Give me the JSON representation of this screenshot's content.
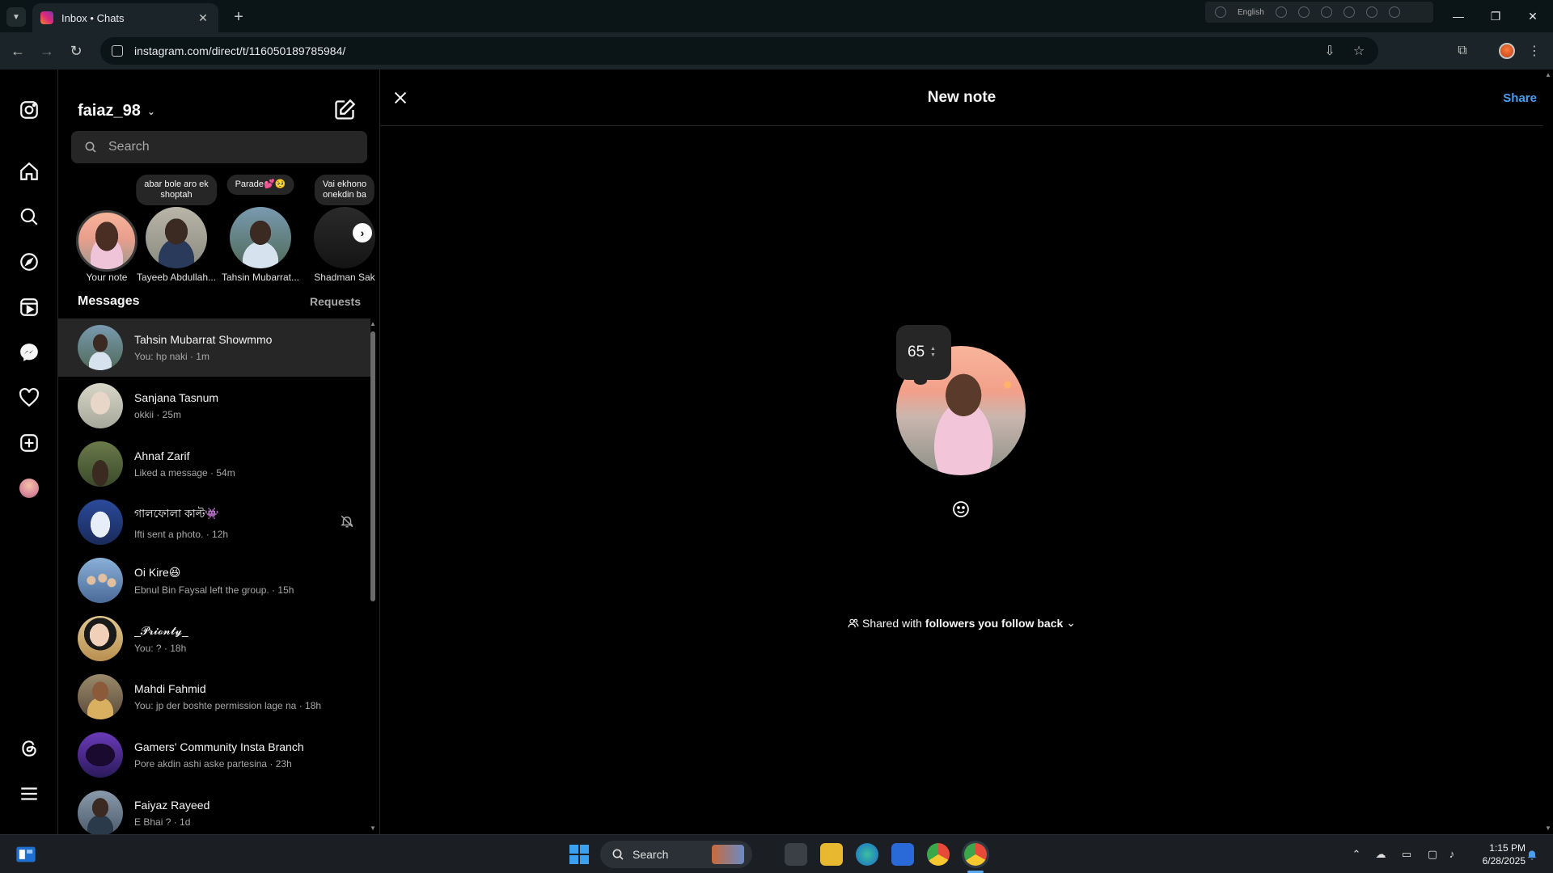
{
  "browser": {
    "tab_title": "Inbox • Chats",
    "url": "instagram.com/direct/t/116050189785984/",
    "ext_language": "English",
    "tab_close": "✕",
    "new_tab": "+"
  },
  "inbox": {
    "username": "faiaz_98",
    "search_placeholder": "Search",
    "notes": [
      {
        "bubble": "",
        "name": "Your note"
      },
      {
        "bubble": "abar bole aro ek\nshoptah",
        "name": "Tayeeb Abdullah..."
      },
      {
        "bubble": "Parade💕🥺",
        "name": "Tahsin Mubarrat..."
      },
      {
        "bubble": "Vai ekhono\nonekdin ba",
        "name": "Shadman Sak"
      }
    ],
    "messages_label": "Messages",
    "requests_label": "Requests",
    "conversations": [
      {
        "name": "Tahsin Mubarrat Showmmo",
        "preview": "You: hp naki · 1m",
        "avatar_color": "#5c7a6b",
        "active": true,
        "muted": false
      },
      {
        "name": "Sanjana Tasnum",
        "preview": "okkii · 25m",
        "avatar_color": "#c9c7b8",
        "active": false,
        "muted": false
      },
      {
        "name": "Ahnaf Zarif",
        "preview": "Liked a message · 54m",
        "avatar_color": "#4a5a3a",
        "active": false,
        "muted": false
      },
      {
        "name": "গালফোলা কাল্ট👾",
        "preview": "Ifti sent a photo. · 12h",
        "avatar_color": "#2a4a9a",
        "active": false,
        "muted": true
      },
      {
        "name": "Oi Kire😆",
        "preview": "Ebnul Bin Faysal left the group. · 15h",
        "avatar_color": "#6a8ab0",
        "active": false,
        "muted": false
      },
      {
        "name": "_𝓟𝓻𝓲𝓸𝓷𝓽𝔂_",
        "preview": "You: ? · 18h",
        "avatar_color": "#d0b070",
        "active": false,
        "muted": false
      },
      {
        "name": "Mahdi Fahmid",
        "preview": "You: jp der boshte permission lage na · 18h",
        "avatar_color": "#7a6a4a",
        "active": false,
        "muted": false
      },
      {
        "name": "Gamers' Community Insta Branch",
        "preview": "Pore akdin ashi aske partesina · 23h",
        "avatar_color": "#4a2a8a",
        "active": false,
        "muted": false
      },
      {
        "name": "Faiyaz Rayeed",
        "preview": "E Bhai ? · 1d",
        "avatar_color": "#5a6a7a",
        "active": false,
        "muted": false
      }
    ]
  },
  "note_panel": {
    "title": "New note",
    "share_label": "Share",
    "note_value": "65",
    "shared_prefix": "Shared with",
    "shared_audience": "followers you follow back"
  },
  "taskbar": {
    "search_label": "Search",
    "time": "1:15 PM",
    "date": "6/28/2025"
  },
  "colors": {
    "accent_blue": "#4a9df0",
    "background": "#000000",
    "surface": "#262626"
  }
}
